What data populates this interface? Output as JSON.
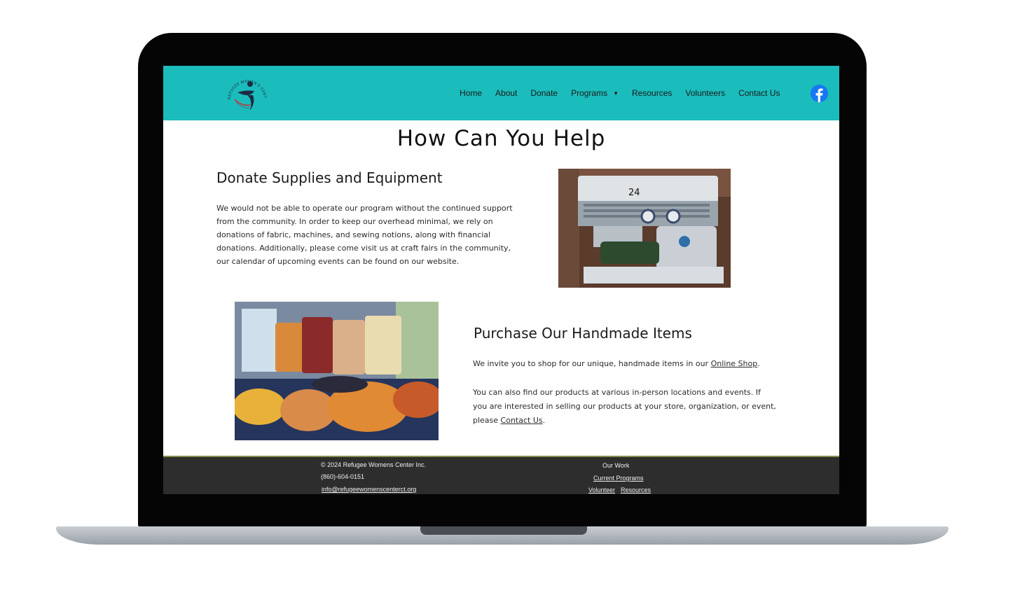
{
  "nav": {
    "items": [
      "Home",
      "About",
      "Donate",
      "Programs",
      "Resources",
      "Volunteers",
      "Contact Us"
    ]
  },
  "logo": {
    "arc_text": "REFUGEE WOMEN'S CENTER"
  },
  "page": {
    "title": "How Can You Help"
  },
  "donate_section": {
    "heading": "Donate Supplies and Equipment",
    "lines": [
      "We would not be able to operate our program without the continued support",
      "from the community. In order to keep our overhead minimal, we rely on",
      "donations of fabric, machines, and sewing notions, along with financial",
      "donations. Additionally, please come visit us at craft fairs in the community,",
      "our calendar of upcoming events can be found on our website."
    ],
    "photo_label": "24"
  },
  "purchase_section": {
    "heading": "Purchase Our Handmade Items",
    "p1_text": "We invite you to shop for our unique, handmade items in our ",
    "p1_link": "Online Shop",
    "p1_end": ".",
    "p2_line1": "You can also find our products at various in-person locations and events. If",
    "p2_line2": "you are interested in selling our products at your store, organization, or event,",
    "p2_line3": "please ",
    "p2_link": "Contact Us",
    "p2_end": "."
  },
  "footer": {
    "copyright": "© 2024 Refugee Womens Center Inc.",
    "phone": "(860)-604-0151",
    "email": "info@refugeewomenscenterct.org",
    "our_work": "Our Work",
    "current_programs": "Current Programs",
    "volunteer": "Volunteer",
    "resources": "Resources"
  },
  "colors": {
    "header": "#1bbcbc",
    "footer": "#2d2d2d",
    "facebook": "#1877f2",
    "logo_figure": "#1d2a44",
    "logo_accent": "#c0392b"
  },
  "icons": {
    "social": "facebook-icon"
  }
}
